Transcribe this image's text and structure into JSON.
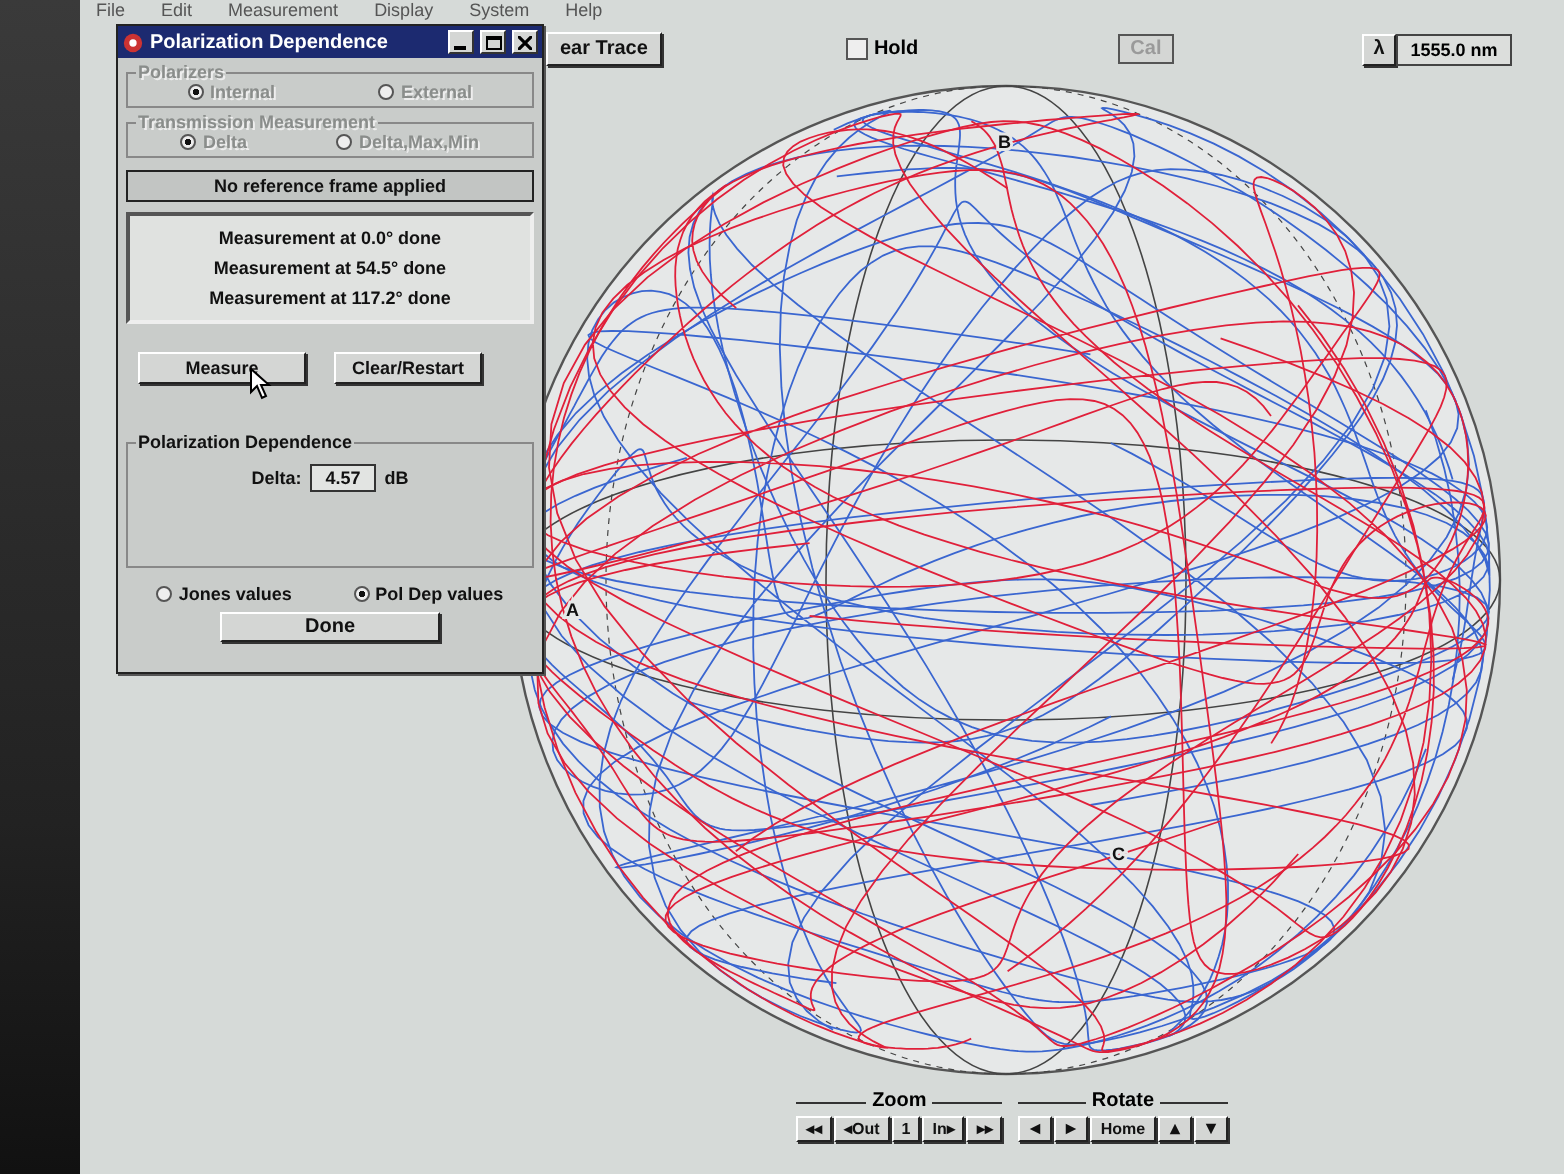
{
  "menu": [
    "File",
    "Edit",
    "Measurement",
    "Display",
    "System",
    "Help"
  ],
  "toolbar": {
    "clear_trace": "ear Trace",
    "hold": {
      "label": "Hold",
      "checked": false
    },
    "cal": {
      "label": "Cal",
      "disabled": true
    },
    "lambda": "λ",
    "wavelength": "1555.0 nm"
  },
  "sphere": {
    "labels": [
      "B",
      "A",
      "C"
    ]
  },
  "zoom": {
    "label": "Zoom",
    "buttons": [
      "◂◂",
      "◂Out",
      "1",
      "In▸",
      "▸▸"
    ]
  },
  "rotate": {
    "label": "Rotate",
    "buttons": [
      {
        "kind": "left"
      },
      {
        "kind": "right"
      },
      {
        "kind": "text",
        "label": "Home"
      },
      {
        "kind": "up"
      },
      {
        "kind": "down"
      }
    ]
  },
  "dialog": {
    "title": "Polarization Dependence",
    "polarizers": {
      "label": "Polarizers",
      "disabled": true,
      "options": [
        {
          "label": "Internal",
          "selected": true
        },
        {
          "label": "External",
          "selected": false
        }
      ]
    },
    "transmission": {
      "label": "Transmission Measurement",
      "disabled": true,
      "options": [
        {
          "label": "Delta",
          "selected": true
        },
        {
          "label": "Delta,Max,Min",
          "selected": false
        }
      ]
    },
    "reference_status": "No reference frame applied",
    "log": [
      "Measurement at 0.0° done",
      "Measurement at 54.5° done",
      "Measurement at 117.2° done"
    ],
    "buttons": [
      "Measure",
      "Clear/Restart"
    ],
    "result": {
      "label": "Polarization Dependence",
      "field_label": "Delta:",
      "value": "4.57",
      "unit": "dB"
    },
    "display_mode": [
      {
        "label": "Jones values",
        "selected": false
      },
      {
        "label": "Pol Dep values",
        "selected": true
      }
    ],
    "done": "Done"
  }
}
